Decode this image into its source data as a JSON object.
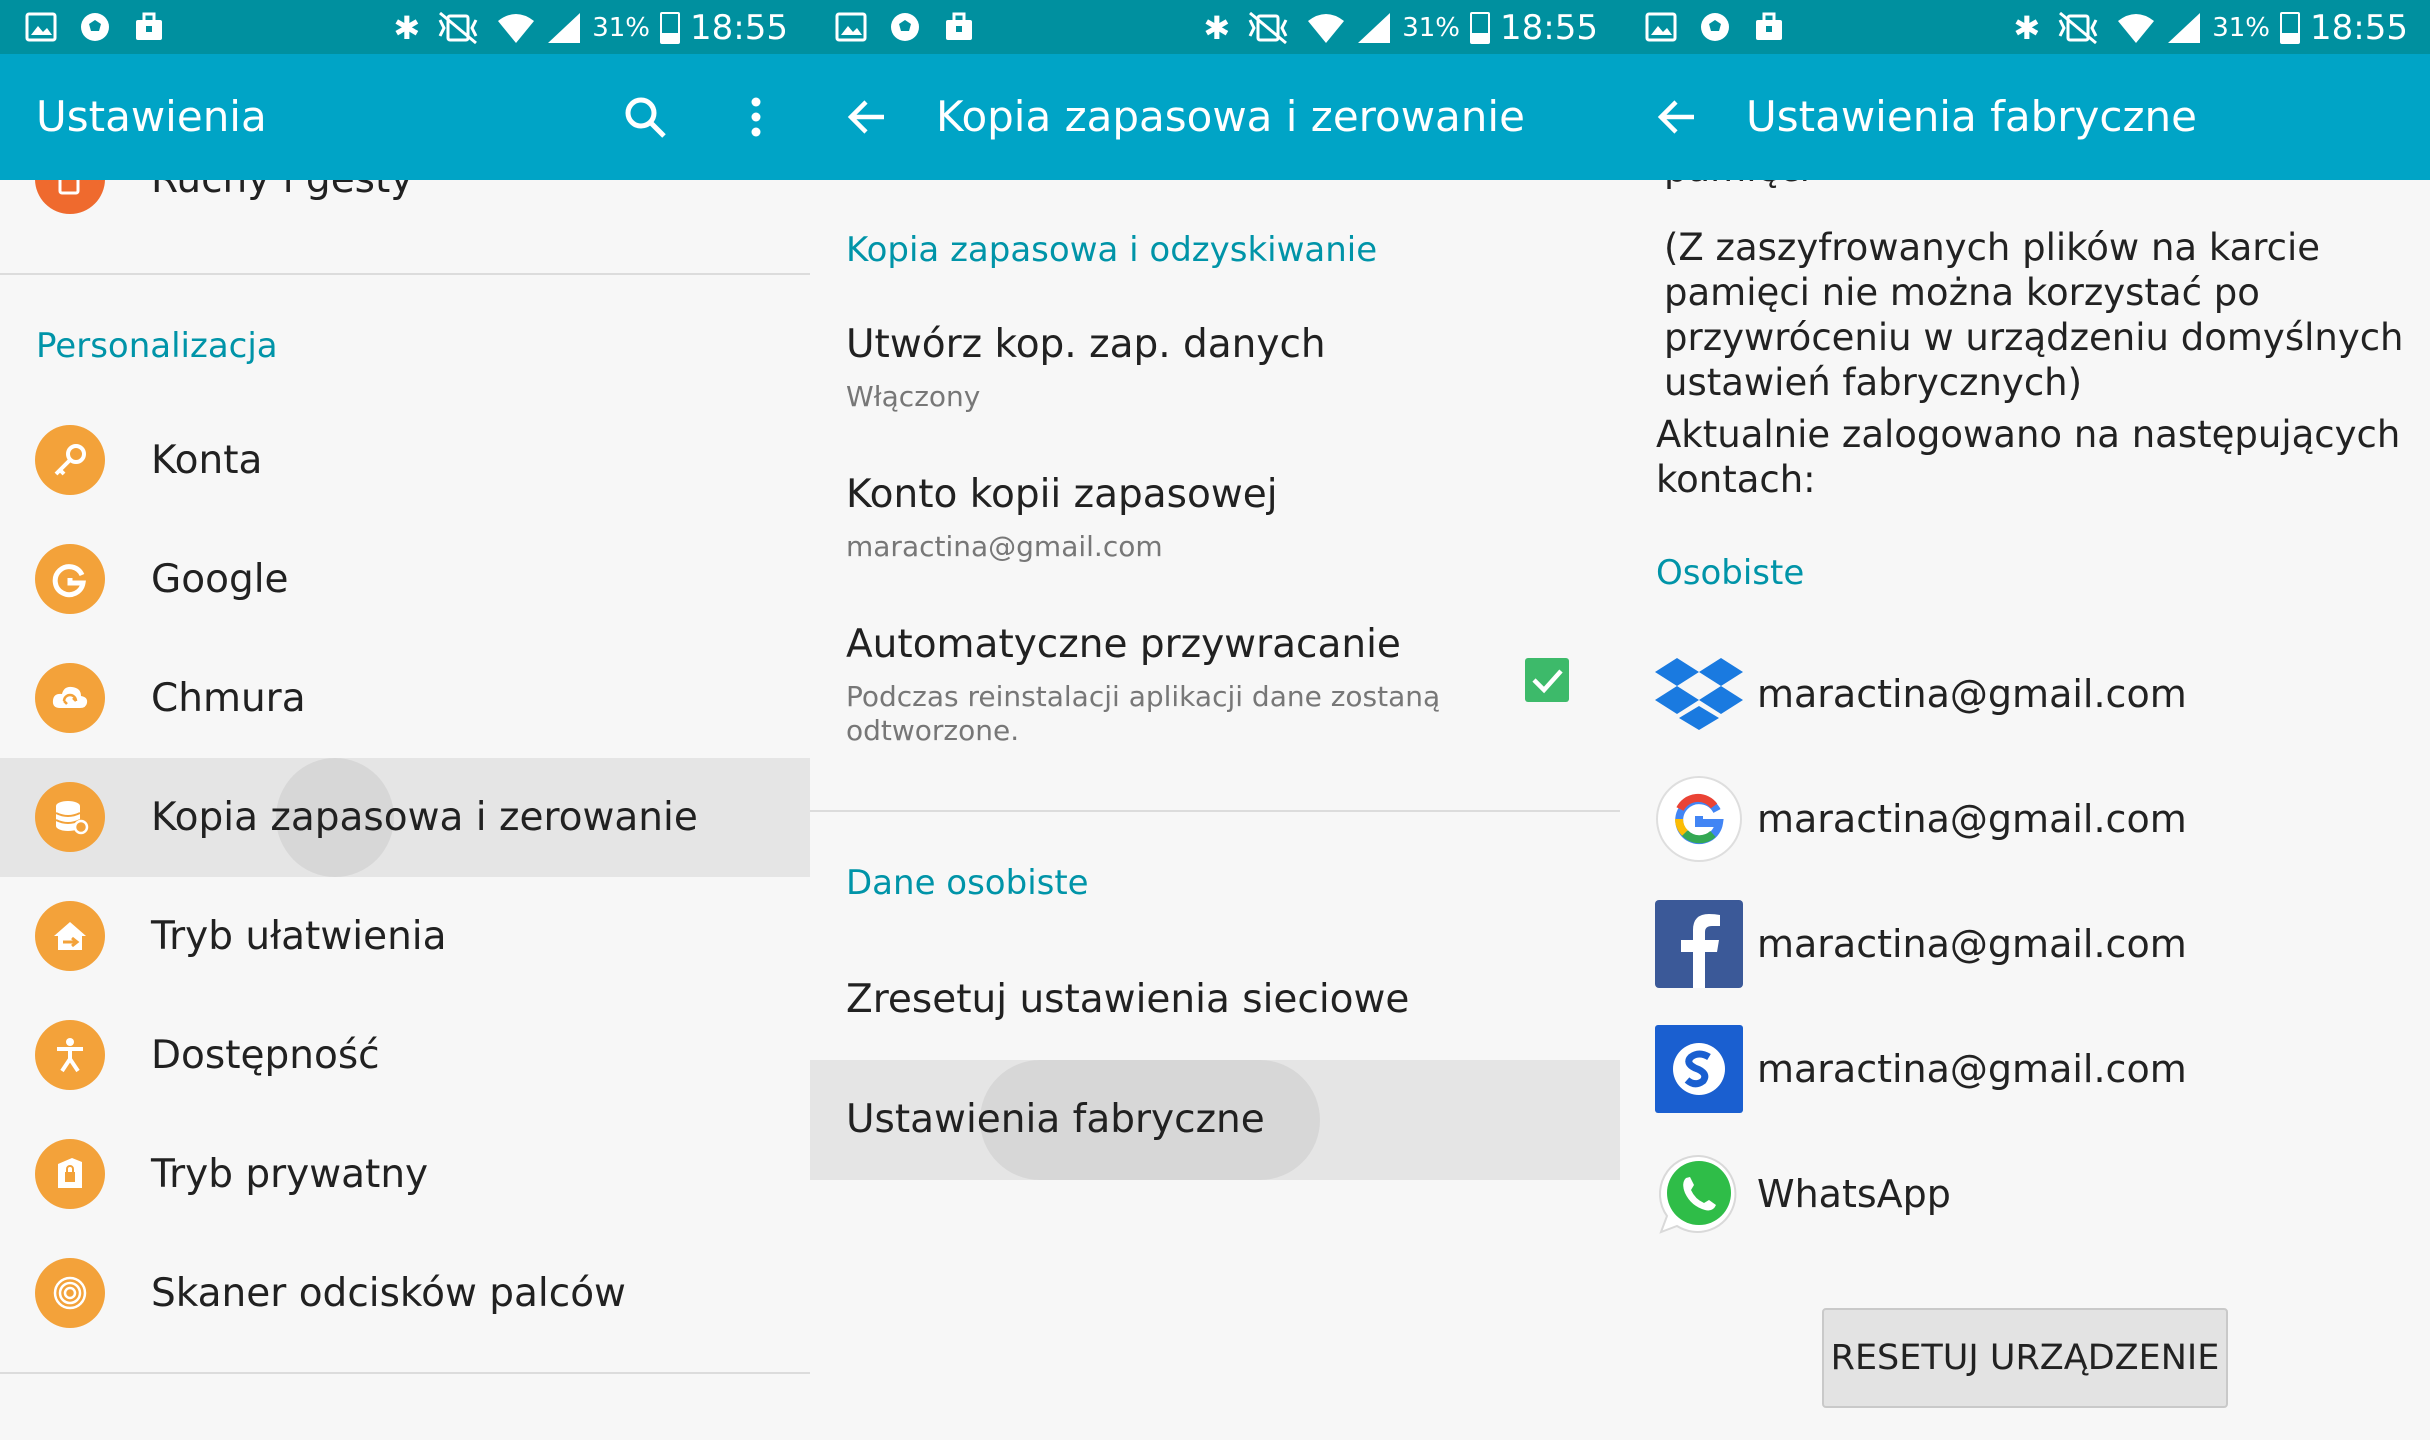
{
  "status": {
    "battery": "31%",
    "time": "18:55"
  },
  "colors": {
    "status_bar": "#00909f",
    "app_bar": "#00a4c6",
    "accent": "#0094a8",
    "icon_orange": "#f3a23a",
    "check_green": "#3dba6a"
  },
  "panel1": {
    "title": "Ustawienia",
    "top_item": "Ruchy i gesty",
    "section": "Personalizacja",
    "items": [
      {
        "label": "Konta",
        "icon": "key-icon"
      },
      {
        "label": "Google",
        "icon": "google-g-icon"
      },
      {
        "label": "Chmura",
        "icon": "cloud-icon"
      },
      {
        "label": "Kopia zapasowa i zerowanie",
        "icon": "database-icon",
        "selected": true
      },
      {
        "label": "Tryb ułatwienia",
        "icon": "easy-home-icon"
      },
      {
        "label": "Dostępność",
        "icon": "accessibility-icon"
      },
      {
        "label": "Tryb prywatny",
        "icon": "private-lock-icon"
      },
      {
        "label": "Skaner odcisków palców",
        "icon": "fingerprint-icon"
      }
    ]
  },
  "panel2": {
    "title": "Kopia zapasowa i zerowanie",
    "section1": "Kopia zapasowa i odzyskiwanie",
    "backup": {
      "title": "Utwórz kop. zap. danych",
      "sub": "Włączony"
    },
    "account": {
      "title": "Konto kopii zapasowej",
      "sub": "maractina@gmail.com"
    },
    "restore": {
      "title": "Automatyczne przywracanie",
      "sub": "Podczas reinstalacji aplikacji dane zostaną odtworzone.",
      "checked": true
    },
    "section2": "Dane osobiste",
    "network": "Zresetuj ustawienia sieciowe",
    "factory": "Ustawienia fabryczne"
  },
  "panel3": {
    "title": "Ustawienia fabryczne",
    "partial": "pamięci",
    "note": [
      "(Z zaszyfrowanych plików na karcie",
      "pamięci nie można korzystać po",
      "przywróceniu w urządzeniu domyślnych",
      "ustawień fabrycznych)"
    ],
    "logged": [
      "Aktualnie zalogowano na następujących",
      "kontach:"
    ],
    "section": "Osobiste",
    "accounts": [
      {
        "label": "maractina@gmail.com",
        "icon": "dropbox-icon"
      },
      {
        "label": "maractina@gmail.com",
        "icon": "google-icon"
      },
      {
        "label": "maractina@gmail.com",
        "icon": "facebook-icon"
      },
      {
        "label": "maractina@gmail.com",
        "icon": "samsung-account-icon"
      },
      {
        "label": "WhatsApp",
        "icon": "whatsapp-icon"
      }
    ],
    "button": "RESETUJ URZĄDZENIE"
  }
}
